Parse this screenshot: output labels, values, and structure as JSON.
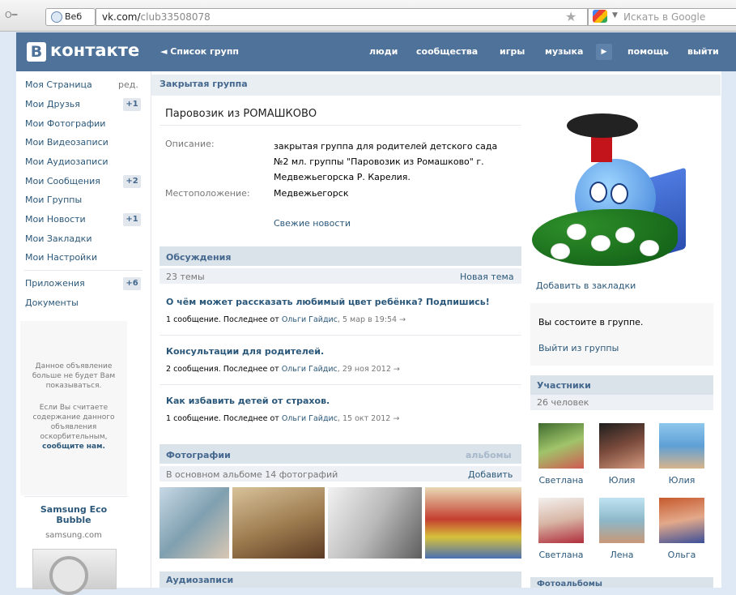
{
  "browser": {
    "tab_label": "Веб",
    "url_domain": "vk.com/",
    "url_path": "club33508078",
    "search_placeholder": "Искать в Google"
  },
  "header": {
    "logo_letter": "В",
    "logo_text": "контакте",
    "back_link": "◄ Список групп",
    "nav": [
      "люди",
      "сообщества",
      "игры",
      "музыка",
      "помощь",
      "выйти"
    ]
  },
  "sidebar": {
    "items": [
      {
        "label": "Моя Страница",
        "badge": "ред."
      },
      {
        "label": "Мои Друзья",
        "badge": "+1"
      },
      {
        "label": "Мои Фотографии",
        "badge": ""
      },
      {
        "label": "Мои Видеозаписи",
        "badge": ""
      },
      {
        "label": "Мои Аудиозаписи",
        "badge": ""
      },
      {
        "label": "Мои Сообщения",
        "badge": "+2"
      },
      {
        "label": "Мои Группы",
        "badge": ""
      },
      {
        "label": "Мои Новости",
        "badge": "+1"
      },
      {
        "label": "Мои Закладки",
        "badge": ""
      },
      {
        "label": "Мои Настройки",
        "badge": ""
      },
      {
        "label": "Приложения",
        "badge": "+6"
      },
      {
        "label": "Документы",
        "badge": ""
      }
    ],
    "ad": {
      "hidden_notice": "Данное объявление больше не будет Вам показываться.",
      "report_text": "Если Вы считаете содержание данного объявления оскорбительным,",
      "report_link": "сообщите нам.",
      "sponsor_title": "Samsung Eco Bubble",
      "sponsor_domain": "samsung.com"
    }
  },
  "group": {
    "type_label": "Закрытая группа",
    "name": "Паровозик из РОМАШКОВО",
    "description_label": "Описание:",
    "description": [
      "закрытая группа для родителей детского сада",
      "№2 мл. группы \"Паровозик из Ромашково\" г.",
      "Медвежьегорска Р. Карелия."
    ],
    "location_label": "Местоположение:",
    "location": "Медвежьегорск",
    "news_link": "Свежие новости"
  },
  "discussions": {
    "title": "Обсуждения",
    "count": "23 темы",
    "new_topic": "Новая тема",
    "topics": [
      {
        "title": "О чём может рассказать любимый цвет ребёнка? Подпишись!",
        "count": "1 сообщение.",
        "last_prefix": "Последнее от",
        "author": "Ольги Гайдис",
        "date": ", 5 мар в 19:54"
      },
      {
        "title": "Консультации для родителей.",
        "count": "2 сообщения.",
        "last_prefix": "Последнее от",
        "author": "Ольги Гайдис",
        "date": ", 29 ноя 2012"
      },
      {
        "title": "Как избавить детей от страхов.",
        "count": "1 сообщение.",
        "last_prefix": "Последнее от",
        "author": "Ольги Гайдис",
        "date": ", 15 окт 2012"
      }
    ]
  },
  "photos": {
    "title": "Фотографии",
    "albums_link": "альбомы",
    "summary": "В основном альбоме 14 фотографий",
    "add": "Добавить"
  },
  "audio": {
    "title": "Аудиозаписи"
  },
  "right": {
    "bookmark": "Добавить в закладки",
    "membership_status": "Вы состоите в группе.",
    "leave": "Выйти из группы",
    "members_title": "Участники",
    "members_count": "26 человек",
    "members": [
      "Светлана",
      "Юлия",
      "Юлия",
      "Светлана",
      "Лена",
      "Ольга"
    ],
    "albums_title": "Фотоальбомы"
  },
  "colors": {
    "header_blue": "#4e729a",
    "link_blue": "#2b587a",
    "section_bg": "#dae2ea"
  }
}
